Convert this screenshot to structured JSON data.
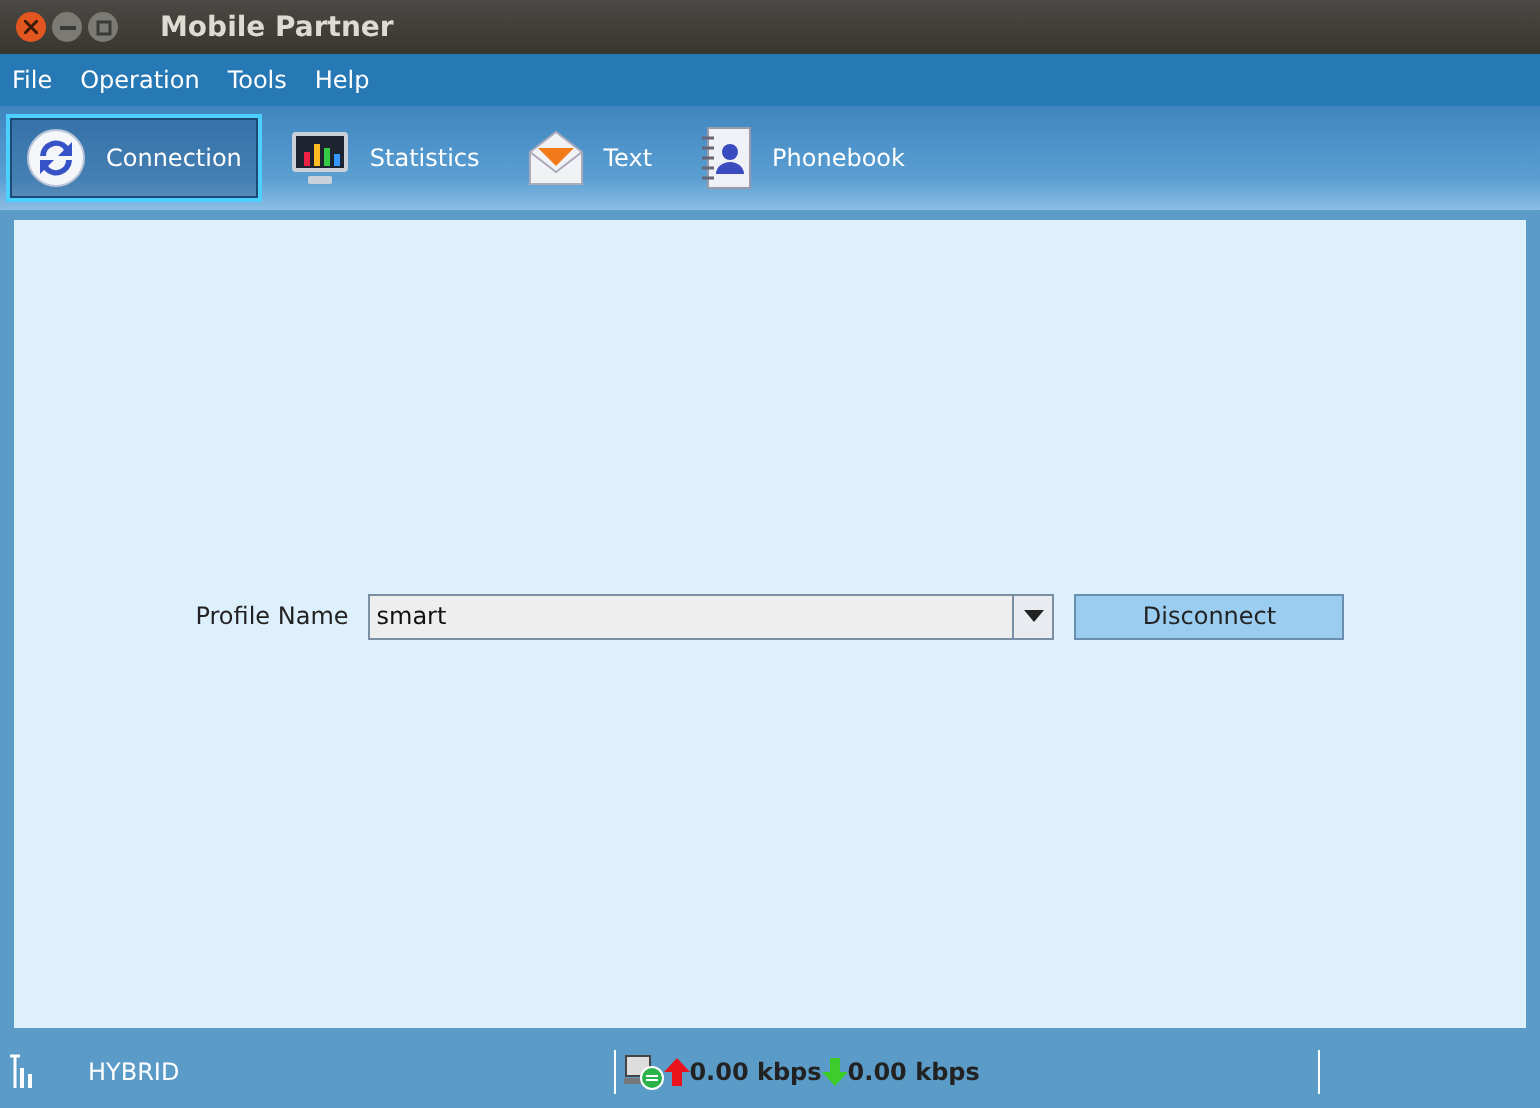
{
  "window": {
    "title": "Mobile Partner"
  },
  "menu": [
    "File",
    "Operation",
    "Tools",
    "Help"
  ],
  "tabs": [
    {
      "label": "Connection",
      "selected": true
    },
    {
      "label": "Statistics",
      "selected": false
    },
    {
      "label": "Text",
      "selected": false
    },
    {
      "label": "Phonebook",
      "selected": false
    }
  ],
  "profile": {
    "label": "Profile Name",
    "value": "smart",
    "button": "Disconnect"
  },
  "status_bar": {
    "network": "HYBRID",
    "upload": "0.00 kbps",
    "download": "0.00 kbps"
  }
}
